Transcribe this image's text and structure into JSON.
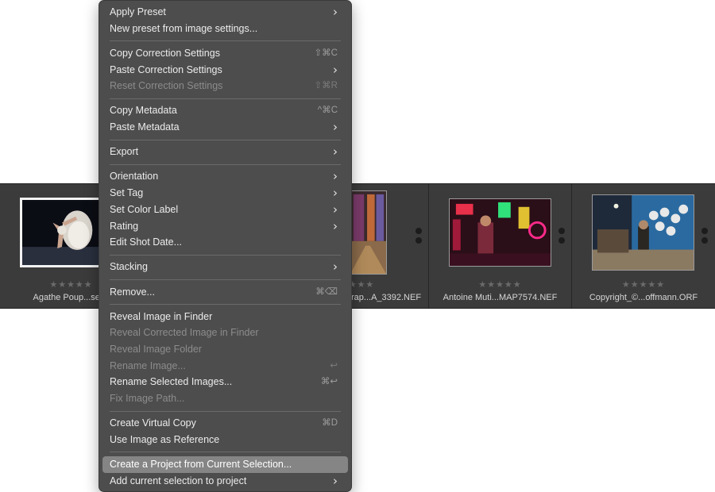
{
  "menu": {
    "groups": [
      [
        {
          "label": "Apply Preset",
          "submenu": true
        },
        {
          "label": "New preset from image settings..."
        }
      ],
      [
        {
          "label": "Copy Correction Settings",
          "shortcut": "⇧⌘C"
        },
        {
          "label": "Paste Correction Settings",
          "submenu": true
        },
        {
          "label": "Reset Correction Settings",
          "shortcut": "⇧⌘R",
          "disabled": true
        }
      ],
      [
        {
          "label": "Copy Metadata",
          "shortcut": "^⌘C"
        },
        {
          "label": "Paste Metadata",
          "submenu": true
        }
      ],
      [
        {
          "label": "Export",
          "submenu": true
        }
      ],
      [
        {
          "label": "Orientation",
          "submenu": true
        },
        {
          "label": "Set Tag",
          "submenu": true
        },
        {
          "label": "Set Color Label",
          "submenu": true
        },
        {
          "label": "Rating",
          "submenu": true
        },
        {
          "label": "Edit Shot Date..."
        }
      ],
      [
        {
          "label": "Stacking",
          "submenu": true
        }
      ],
      [
        {
          "label": "Remove...",
          "shortcut": "⌘⌫"
        }
      ],
      [
        {
          "label": "Reveal Image in Finder"
        },
        {
          "label": "Reveal Corrected Image in Finder",
          "disabled": true
        },
        {
          "label": "Reveal Image Folder",
          "disabled": true
        },
        {
          "label": "Rename Image...",
          "shortcut": "↩",
          "disabled": true
        },
        {
          "label": "Rename Selected Images...",
          "shortcut": "⌘↩"
        },
        {
          "label": "Fix Image Path...",
          "disabled": true
        }
      ],
      [
        {
          "label": "Create Virtual Copy",
          "shortcut": "⌘D"
        },
        {
          "label": "Use Image as Reference"
        }
      ],
      [
        {
          "label": "Create a Project from Current Selection...",
          "highlighted": true
        },
        {
          "label": "Add current selection to project",
          "submenu": true
        }
      ]
    ]
  },
  "filmstrip": {
    "thumbnails": [
      {
        "filename": "Agathe Poup...sele/",
        "rating": "★★★★★",
        "selected": true
      },
      {
        "filename": "rap...A_3392.NEF",
        "rating": "★★★"
      },
      {
        "filename": "Antoine Muti...MAP7574.NEF",
        "rating": "★★★★★"
      },
      {
        "filename": "Copyright_©...offmann.ORF",
        "rating": "★★★★★"
      }
    ]
  },
  "icons": {
    "submenu": "chevron-right-icon",
    "options": "more-dots-icon"
  },
  "colors": {
    "menu_bg": "#4d4d4d",
    "highlight": "#858585",
    "filmstrip_bg": "#393939"
  }
}
